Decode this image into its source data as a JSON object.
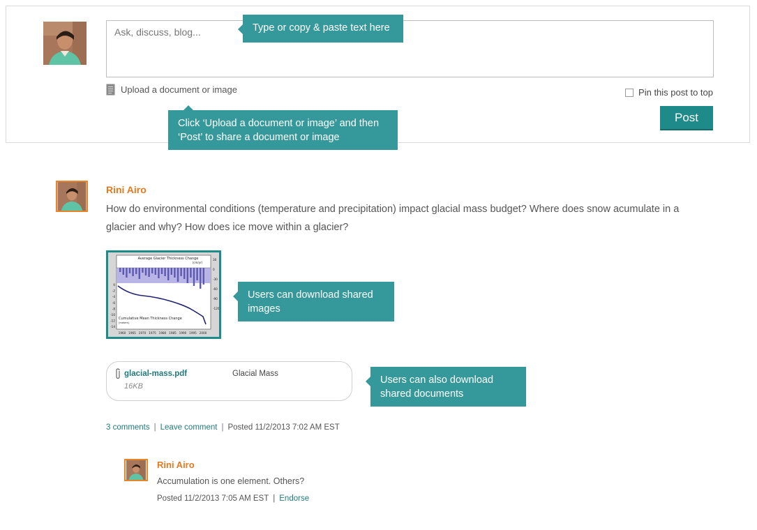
{
  "composer": {
    "placeholder": "Ask, discuss, blog...",
    "upload_label": "Upload a document or image",
    "pin_label": "Pin this post to top",
    "post_label": "Post"
  },
  "tooltips": {
    "input_tip": "Type or copy & paste text here",
    "upload_tip": "Click ‘Upload a document or image’ and then ‘Post’ to share a document or image",
    "image_tip": "Users can download shared images",
    "document_tip": "Users can also download shared documents"
  },
  "post": {
    "author": "Rini Airo",
    "text": "How do environmental conditions (temperature and precipitation) impact glacial mass budget? Where does snow acumulate in a glacier and why? How does ice move within a glacier?",
    "image": {
      "chart_title": "Average Glacier Thickness Change",
      "chart_unit": "(cm/yr)",
      "lower_title": "Cumulative Mean Thickness Change",
      "lower_unit": "(meters)",
      "x_ticks": [
        "1960",
        "1965",
        "1970",
        "1975",
        "1980",
        "1985",
        "1990",
        "1995",
        "2000"
      ],
      "left_ticks": [
        "0",
        "-2",
        "-4",
        "-6",
        "-8",
        "-10",
        "-12",
        "-14"
      ],
      "right_ticks": [
        "30",
        "0",
        "-30",
        "-60",
        "-90",
        "-120"
      ]
    },
    "attachment": {
      "filename": "glacial-mass.pdf",
      "size": "16KB",
      "title": "Glacial Mass"
    },
    "meta": {
      "comments": "3 comments",
      "leave_comment": "Leave comment",
      "separator": "|",
      "posted": "Posted 11/2/2013 7:02 AM EST"
    }
  },
  "reply": {
    "author": "Rini Airo",
    "text": "Accumulation is one element. Others?",
    "posted": "Posted 11/2/2013 7:05 AM EST",
    "separator": "|",
    "endorse": "Endorse"
  },
  "colors": {
    "accent": "#1f8a8a",
    "tooltip": "#35999b",
    "author": "#e8781e",
    "avatar_border": "#e8852b"
  }
}
